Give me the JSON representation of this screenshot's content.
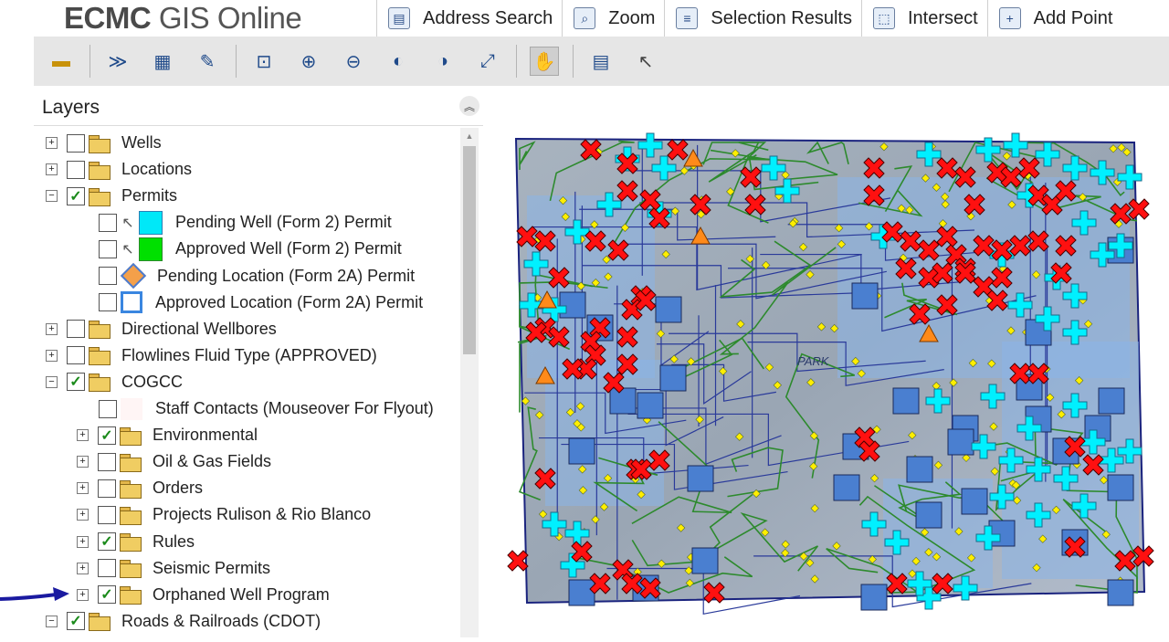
{
  "header": {
    "title_bold": "ECMC",
    "title_rest": "GIS Online",
    "tabs": [
      {
        "label": "Address Search",
        "icon": "address-search-icon"
      },
      {
        "label": "Zoom",
        "icon": "magnifier-icon"
      },
      {
        "label": "Selection Results",
        "icon": "selection-results-icon"
      },
      {
        "label": "Intersect",
        "icon": "intersect-icon"
      },
      {
        "label": "Add Point",
        "icon": "add-point-icon"
      }
    ]
  },
  "toolbar": {
    "tools": [
      "measure-ruler-icon",
      "draw-line-icon",
      "select-features-icon",
      "edit-selection-icon",
      "zoom-extent-icon",
      "zoom-in-icon",
      "zoom-out-icon",
      "zoom-previous-icon",
      "zoom-next-icon",
      "full-extent-icon",
      "pan-hand-icon",
      "export-layer-icon",
      "pointer-icon"
    ]
  },
  "layers": {
    "title": "Layers",
    "items": [
      {
        "label": "Wells",
        "checked": false,
        "expander": "+",
        "kind": "folder",
        "indent": 0
      },
      {
        "label": "Locations",
        "checked": false,
        "expander": "+",
        "kind": "folder",
        "indent": 0
      },
      {
        "label": "Permits",
        "checked": true,
        "expander": "−",
        "kind": "folder",
        "indent": 0
      },
      {
        "label": "Pending Well (Form 2) Permit",
        "checked": false,
        "kind": "legend-cyan",
        "indent": 1
      },
      {
        "label": "Approved Well (Form 2) Permit",
        "checked": false,
        "kind": "legend-green",
        "indent": 1
      },
      {
        "label": "Pending Location (Form 2A) Permit",
        "checked": false,
        "kind": "legend-diamond",
        "indent": 1
      },
      {
        "label": "Approved Location (Form 2A) Permit",
        "checked": false,
        "kind": "legend-outline",
        "indent": 1
      },
      {
        "label": "Directional Wellbores",
        "checked": false,
        "expander": "+",
        "kind": "folder",
        "indent": 0
      },
      {
        "label": "Flowlines Fluid Type (APPROVED)",
        "checked": false,
        "expander": "+",
        "kind": "folder",
        "indent": 0
      },
      {
        "label": "COGCC",
        "checked": true,
        "expander": "−",
        "kind": "folder",
        "indent": 0
      },
      {
        "label": "Staff Contacts (Mouseover For Flyout)",
        "checked": false,
        "kind": "legend-pink",
        "indent": 1
      },
      {
        "label": "Environmental",
        "checked": true,
        "expander": "+",
        "kind": "folder",
        "indent": 1
      },
      {
        "label": "Oil & Gas Fields",
        "checked": false,
        "expander": "+",
        "kind": "folder",
        "indent": 1
      },
      {
        "label": "Orders",
        "checked": false,
        "expander": "+",
        "kind": "folder",
        "indent": 1
      },
      {
        "label": "Projects Rulison & Rio Blanco",
        "checked": false,
        "expander": "+",
        "kind": "folder",
        "indent": 1
      },
      {
        "label": "Rules",
        "checked": true,
        "expander": "+",
        "kind": "folder",
        "indent": 1
      },
      {
        "label": "Seismic Permits",
        "checked": false,
        "expander": "+",
        "kind": "folder",
        "indent": 1
      },
      {
        "label": "Orphaned Well Program",
        "checked": true,
        "expander": "+",
        "kind": "folder",
        "indent": 1
      },
      {
        "label": "Roads & Railroads (CDOT)",
        "checked": true,
        "expander": "−",
        "kind": "folder",
        "indent": 0
      }
    ]
  },
  "map": {
    "label": "PARK",
    "colors": {
      "state_fill": "#9fb3c8",
      "water": "#8ab4e8",
      "roads": "#2d8a2d",
      "counties": "#2a3a9a",
      "well_x": "#ff1010",
      "permit_cross": "#00f0ff",
      "location_square": "#4a7fd0",
      "diamond_marker": "#ffee00",
      "triangle": "#ff8a1a"
    }
  },
  "annotation": {
    "color": "#1a1aa0"
  }
}
